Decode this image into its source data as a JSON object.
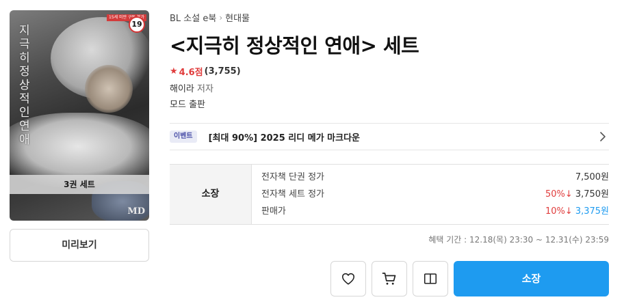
{
  "cover": {
    "title_vertical": "지극히 정상적인 연애",
    "rating_banner": "15세 미만 구독 불가",
    "age_badge": "19",
    "set_label": "3권 세트",
    "publisher_logo": "MD"
  },
  "preview_button": "미리보기",
  "breadcrumb": {
    "items": [
      "BL 소설 e북",
      "현대물"
    ]
  },
  "title": "<지극히 정상적인 연애> 세트",
  "rating": {
    "score": "4.6점",
    "count": "(3,755)"
  },
  "author": {
    "name": "해이라",
    "role": "저자"
  },
  "publisher": {
    "name": "모드",
    "role": "출판"
  },
  "event": {
    "tag": "이벤트",
    "text": "[최대 90%] 2025 리디 메가 마크다운"
  },
  "price": {
    "label": "소장",
    "rows": [
      {
        "label": "전자책 단권 정가",
        "discount": "",
        "value": "7,500원"
      },
      {
        "label": "전자책 세트 정가",
        "discount": "50%↓",
        "value": "3,750원"
      },
      {
        "label": "판매가",
        "discount": "10%↓",
        "value": "3,375원"
      }
    ]
  },
  "benefit_period": "혜택 기간 : 12.18(목) 23:30 ~ 12.31(수) 23:59",
  "actions": {
    "own_button": "소장"
  },
  "icons": [
    "star-icon",
    "chevron-right-icon",
    "heart-icon",
    "cart-icon",
    "book-open-icon"
  ],
  "colors": {
    "accent_blue": "#1e9bf0",
    "discount_red": "#e03c3c",
    "event_tag_bg": "#e9ebf6"
  }
}
